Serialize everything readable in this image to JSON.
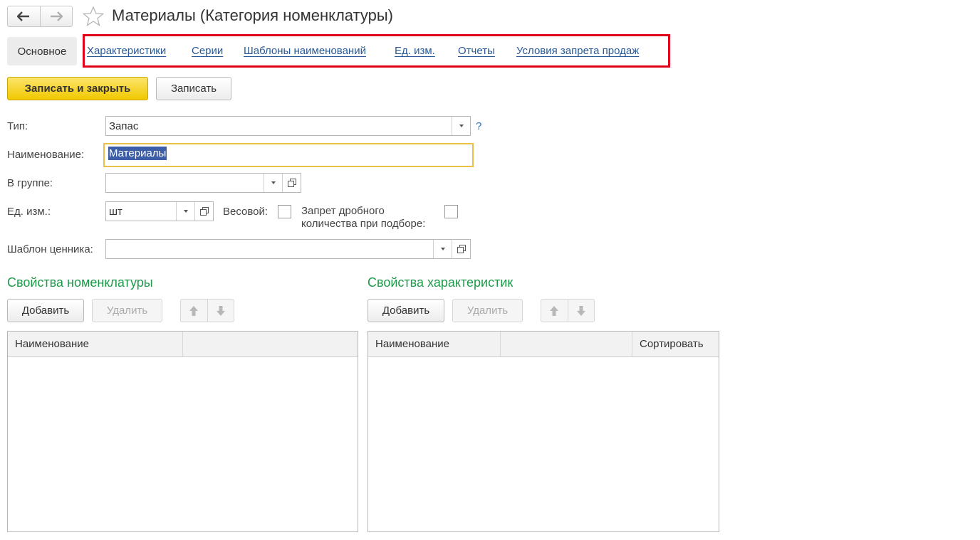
{
  "window": {
    "title": "Материалы (Категория номенклатуры)"
  },
  "tabs": {
    "main": "Основное",
    "links": [
      "Характеристики",
      "Серии",
      "Шаблоны наименований",
      "Ед. изм.",
      "Отчеты",
      "Условия запрета продаж"
    ]
  },
  "toolbar": {
    "save_close": "Записать и закрыть",
    "save": "Записать"
  },
  "form": {
    "type_label": "Тип:",
    "type_value": "Запас",
    "help": "?",
    "name_label": "Наименование:",
    "name_value": "Материалы",
    "group_label": "В группе:",
    "group_value": "",
    "unit_label": "Ед. изм.:",
    "unit_value": "шт",
    "weight_label": "Весовой:",
    "weight_checked": false,
    "fraction_label_1": "Запрет дробного",
    "fraction_label_2": "количества при подборе:",
    "fraction_checked": false,
    "price_tag_label": "Шаблон ценника:",
    "price_tag_value": ""
  },
  "nomenclature_props": {
    "title": "Свойства номенклатуры",
    "add": "Добавить",
    "delete": "Удалить",
    "columns": [
      "Наименование",
      ""
    ]
  },
  "characteristic_props": {
    "title": "Свойства характеристик",
    "add": "Добавить",
    "delete": "Удалить",
    "columns": [
      "Наименование",
      "",
      "Сортировать"
    ]
  },
  "colors": {
    "accent_yellow": "#f1c800",
    "section_green": "#1e9a4a",
    "link_blue": "#2a5a96",
    "highlight_red": "#e0001a"
  }
}
